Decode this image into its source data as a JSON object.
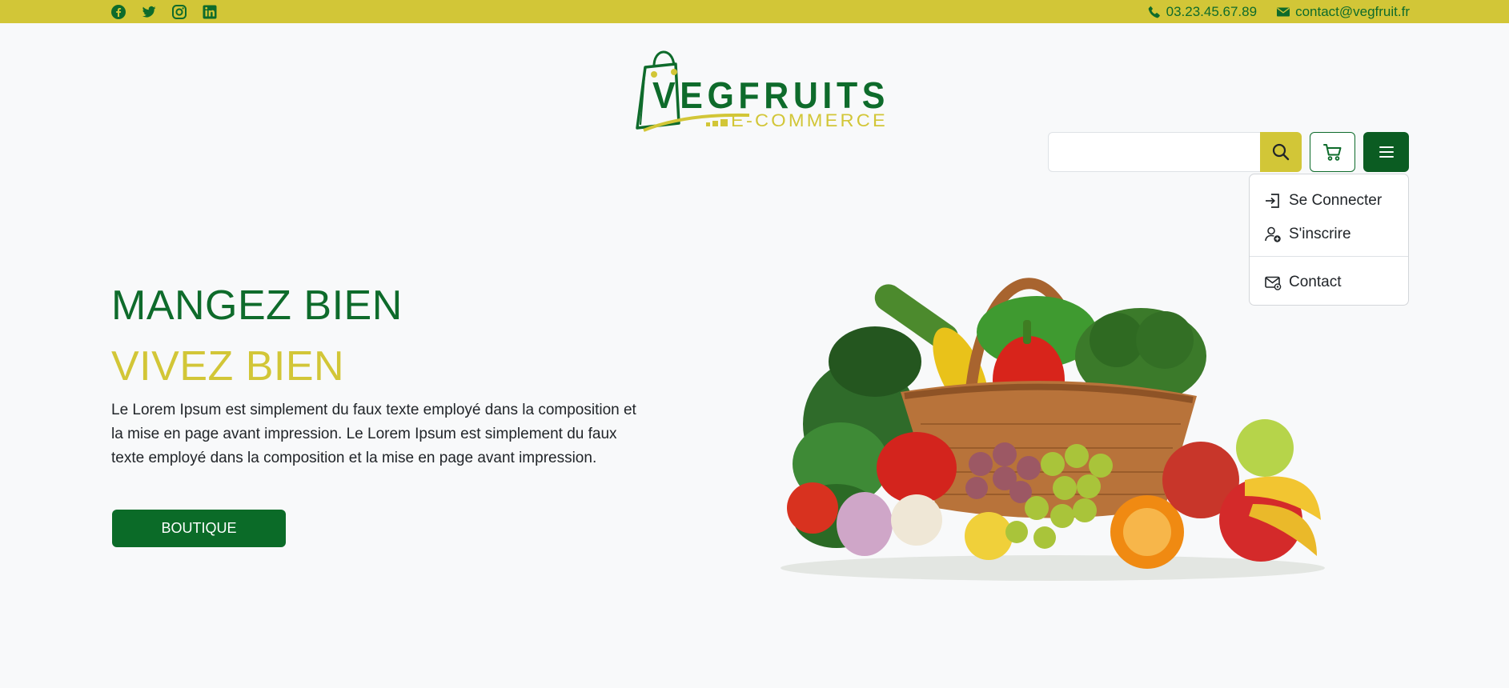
{
  "topbar": {
    "background": "#d2c637",
    "social_icons": [
      "facebook-icon",
      "twitter-icon",
      "instagram-icon",
      "linkedin-icon"
    ],
    "phone": "03.23.45.67.89",
    "email": "contact@vegfruit.fr"
  },
  "logo": {
    "brand": "VEGFRUITS",
    "tagline": "E-COMMERCE"
  },
  "search": {
    "placeholder": "",
    "value": ""
  },
  "header_buttons": [
    "search-icon",
    "cart-icon",
    "menu-icon"
  ],
  "dropdown": {
    "items": [
      {
        "label": "Se Connecter",
        "icon": "login-icon"
      },
      {
        "label": "S'inscrire",
        "icon": "user-plus-icon"
      },
      {
        "label": "Contact",
        "icon": "envelope-icon"
      }
    ]
  },
  "hero": {
    "title_line1": "MANGEZ BIEN",
    "title_line2": "VIVEZ BIEN",
    "text": "Le Lorem Ipsum est simplement du faux texte employé dans la composition et la mise en page avant impression. Le Lorem Ipsum est simplement du faux texte employé dans la composition et la mise en page avant impression.",
    "button_label": "BOUTIQUE"
  },
  "colors": {
    "primary_green": "#0e6b2b",
    "accent_yellow": "#d2c637",
    "background": "#f8f9fa"
  }
}
